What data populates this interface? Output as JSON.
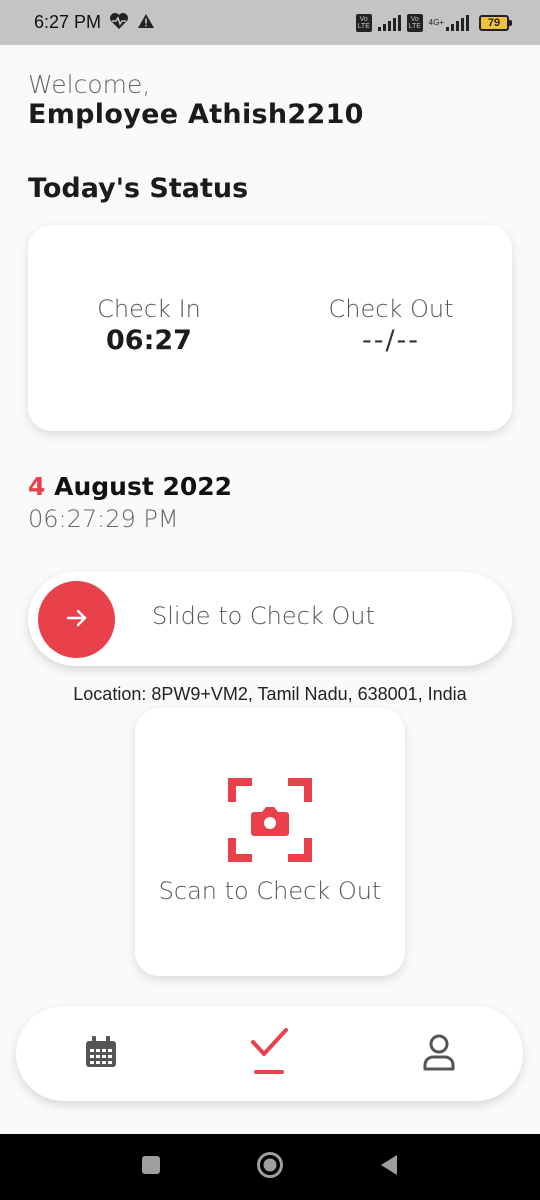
{
  "status_bar": {
    "time": "6:27 PM",
    "left_icons": [
      "heart-pulse-icon",
      "warning-icon"
    ],
    "volte_label": "Vo\nLTE",
    "network_label": "4G+",
    "battery_level": "79"
  },
  "header": {
    "welcome": "Welcome,",
    "employee_name": "Employee Athish2210"
  },
  "status_section": {
    "title": "Today's Status",
    "check_in_label": "Check In",
    "check_in_value": "06:27",
    "check_out_label": "Check Out",
    "check_out_value": "--/--"
  },
  "date": {
    "day": "4",
    "month_year": "August 2022",
    "time": "06:27:29 PM"
  },
  "slider": {
    "label": "Slide to Check Out",
    "icon": "arrow-right-icon"
  },
  "location": "Location: 8PW9+VM2, Tamil Nadu, 638001, India",
  "scan": {
    "label": "Scan to Check Out",
    "icon": "camera-scan-icon"
  },
  "bottom_nav": {
    "items": [
      {
        "icon": "calendar-icon",
        "active": false
      },
      {
        "icon": "check-icon",
        "active": true
      },
      {
        "icon": "profile-icon",
        "active": false
      }
    ]
  },
  "colors": {
    "accent": "#e8414b",
    "status_bar_bg": "#c4c4c4",
    "background": "#fafafa"
  }
}
